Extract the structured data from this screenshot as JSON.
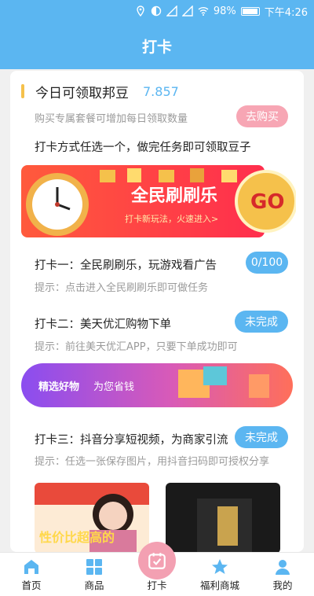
{
  "status_bar": {
    "battery": "98%",
    "time": "下午4:26"
  },
  "header": {
    "title": "打卡"
  },
  "beans": {
    "title": "今日可领取邦豆",
    "value": "7.857",
    "hint": "购买专属套餐可增加每日领取数量",
    "buy_label": "去购买"
  },
  "intro": "打卡方式任选一个，做完任务即可领取豆子",
  "banner1": {
    "title": "全民刷刷乐",
    "subtitle": "打卡新玩法，火速进入>",
    "go_label": "GO"
  },
  "tasks": [
    {
      "title": "打卡一：全民刷刷乐，玩游戏看广告",
      "hint": "提示：点击进入全民刷刷乐即可做任务",
      "status": "0/100"
    },
    {
      "title": "打卡二：美天优汇购物下单",
      "hint": "提示：前往美天优汇APP，只要下单成功即可",
      "status": "未完成"
    },
    {
      "title": "打卡三：抖音分享短视频，为商家引流",
      "hint": "提示：任选一张保存图片，用抖音扫码即可授权分享",
      "status": "未完成"
    }
  ],
  "banner2": {
    "text1": "精选好物",
    "text2": "为您省钱"
  },
  "thumb1": {
    "caption": "性价比超高的"
  },
  "tabbar": {
    "items": [
      {
        "label": "首页",
        "icon": "home-icon"
      },
      {
        "label": "商品",
        "icon": "grid-icon"
      },
      {
        "label": "打卡",
        "icon": "calendar-check-icon"
      },
      {
        "label": "福利商城",
        "icon": "star-icon"
      },
      {
        "label": "我的",
        "icon": "person-icon"
      }
    ]
  },
  "colors": {
    "primary": "#5bb6f1",
    "pink": "#f7a6b4",
    "accent_orange": "#f5c14b"
  }
}
